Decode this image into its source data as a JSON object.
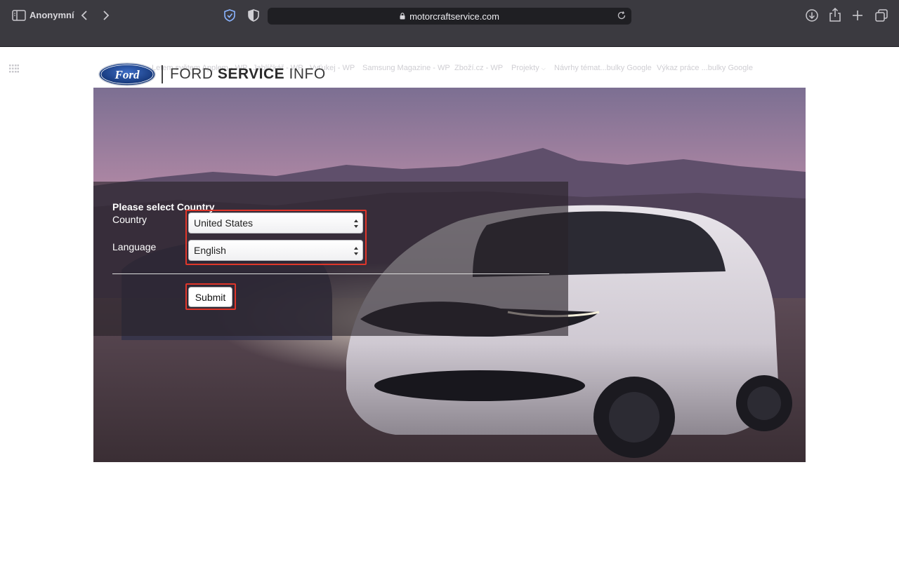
{
  "browser": {
    "profile_label": "Anonymní",
    "url": "motorcraftservice.com",
    "bookmarks": [
      "Letem světem Applem - WP",
      "Jablíčkář - WP",
      "Vyťukej - WP",
      "Samsung Magazine - WP",
      "Zboží.cz - WP",
      "Projekty",
      "Návrhy témat...bulky Google",
      "Výkaz práce ...bulky Google"
    ]
  },
  "page": {
    "logo": {
      "brand": "Ford",
      "title_light_1": "FORD",
      "title_bold": "SERVICE",
      "title_light_2": "INFO"
    },
    "form": {
      "heading": "Please select Country",
      "country_label": "Country",
      "country_value": "United States",
      "language_label": "Language",
      "language_value": "English",
      "submit_label": "Submit"
    }
  },
  "colors": {
    "highlight": "#e0362a",
    "chrome_bg": "#3b3a40",
    "ford_blue": "#1a3f8c"
  }
}
